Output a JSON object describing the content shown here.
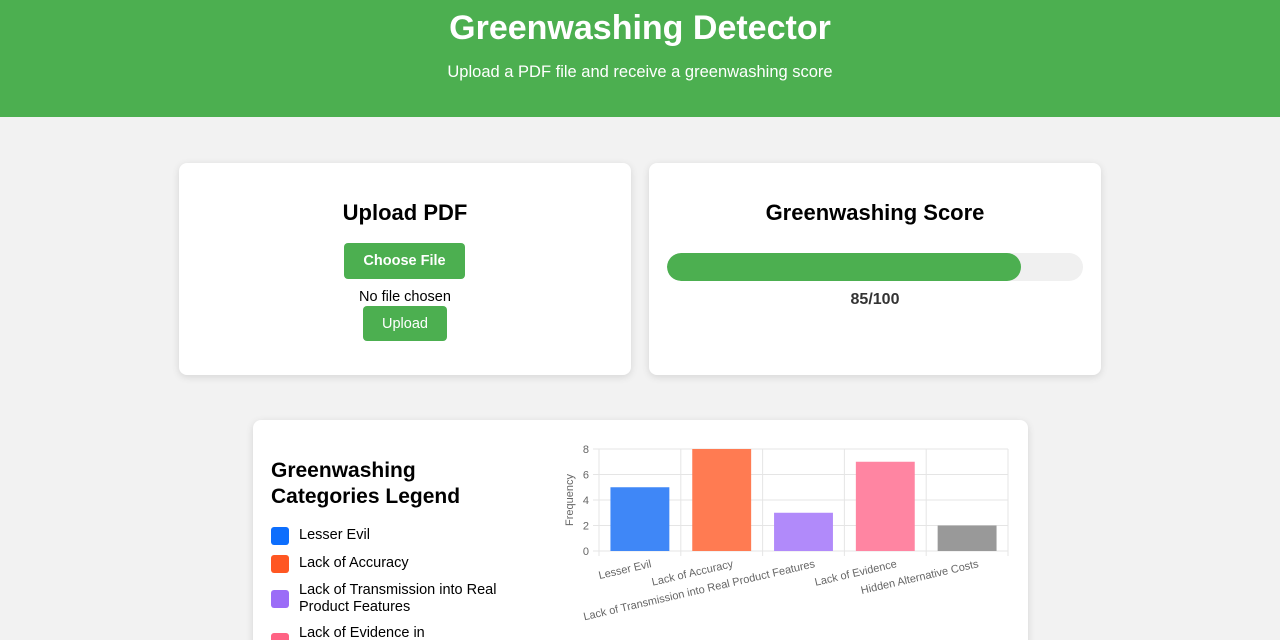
{
  "header": {
    "title": "Greenwashing Detector",
    "subtitle": "Upload a PDF file and receive a greenwashing score"
  },
  "upload": {
    "title": "Upload PDF",
    "choose_label": "Choose File",
    "file_status": "No file chosen",
    "upload_label": "Upload"
  },
  "score": {
    "title": "Greenwashing Score",
    "value": 85,
    "max": 100,
    "display": "85/100",
    "color": "#4caf50"
  },
  "legend": {
    "title": "Greenwashing Categories Legend",
    "items": [
      {
        "label": "Lesser Evil",
        "color": "#0d6efd"
      },
      {
        "label": "Lack of Accuracy",
        "color": "#ff5722"
      },
      {
        "label": "Lack of Transmission into Real Product Features",
        "color": "#9b6cf7"
      },
      {
        "label": "Lack of Evidence in",
        "color": "#ff6384"
      }
    ]
  },
  "chart_data": {
    "type": "bar",
    "categories": [
      "Lesser Evil",
      "Lack of Accuracy",
      "Lack of Transmission into Real Product Features",
      "Lack of Evidence",
      "Hidden Alternative Costs"
    ],
    "values": [
      5,
      8,
      3,
      7,
      2
    ],
    "colors": [
      "#3f87f7",
      "#ff7b52",
      "#b18afa",
      "#ff85a2",
      "#999999"
    ],
    "ylabel": "Frequency",
    "xlabel": "",
    "ylim": [
      0,
      8
    ],
    "yticks": [
      0,
      2,
      4,
      6,
      8
    ],
    "grid": true
  },
  "theme": {
    "accent": "#4caf50",
    "background": "#f2f2f2"
  }
}
